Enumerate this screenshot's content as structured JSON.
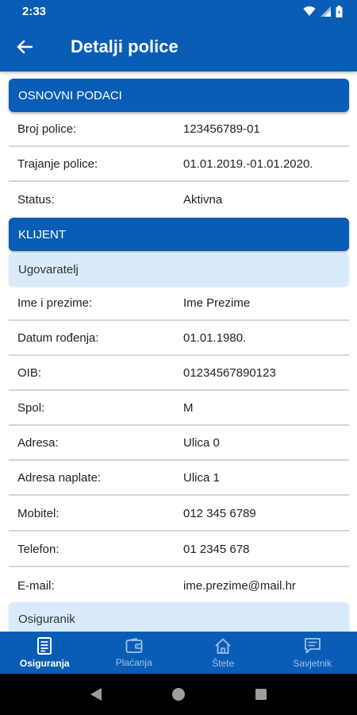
{
  "status_bar": {
    "time": "2:33"
  },
  "app_bar": {
    "title": "Detalji police"
  },
  "sections": {
    "basic": {
      "title": "OSNOVNI PODACI"
    },
    "client": {
      "title": "KLIJENT"
    }
  },
  "basic_rows": [
    {
      "label": "Broj police:",
      "value": "123456789-01"
    },
    {
      "label": "Trajanje police:",
      "value": "01.01.2019.-01.01.2020."
    },
    {
      "label": "Status:",
      "value": "Aktivna"
    }
  ],
  "contractor": {
    "title": "Ugovaratelj"
  },
  "client_rows": [
    {
      "label": "Ime i prezime:",
      "value": "Ime Prezime"
    },
    {
      "label": "Datum rođenja:",
      "value": "01.01.1980."
    },
    {
      "label": "OIB:",
      "value": "01234567890123"
    },
    {
      "label": "Spol:",
      "value": "M"
    },
    {
      "label": "Adresa:",
      "value": "Ulica 0"
    },
    {
      "label": "Adresa naplate:",
      "value": "Ulica 1"
    },
    {
      "label": "Mobitel:",
      "value": "012 345 6789"
    },
    {
      "label": "Telefon:",
      "value": "01 2345 678"
    },
    {
      "label": "E-mail:",
      "value": "ime.prezime@mail.hr"
    }
  ],
  "insured": {
    "title": "Osiguranik"
  },
  "bottom_nav": [
    {
      "label": "Osiguranja",
      "icon": "document-icon",
      "active": true
    },
    {
      "label": "Plaćanja",
      "icon": "wallet-icon",
      "active": false
    },
    {
      "label": "Štete",
      "icon": "house-icon",
      "active": false
    },
    {
      "label": "Savjetnik",
      "icon": "chat-icon",
      "active": false
    }
  ],
  "colors": {
    "primary": "#0a5db5",
    "sub_header": "#d9eafb",
    "divider": "#d6d6d6"
  }
}
